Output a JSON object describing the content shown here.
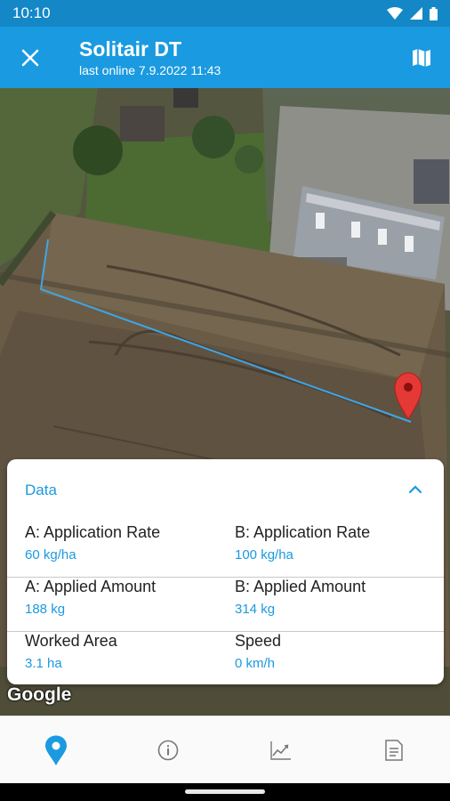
{
  "status_bar": {
    "time": "10:10"
  },
  "header": {
    "title": "Solitair DT",
    "subtitle": "last online 7.9.2022 11:43",
    "close_icon": "close-icon",
    "map_icon": "map-icon",
    "color": "#1a9ae0"
  },
  "map": {
    "attribution": "Google",
    "marker_color": "#e53935",
    "track_color": "#3fa6e6"
  },
  "data_panel": {
    "title": "Data",
    "rows": [
      [
        {
          "label": "A: Application Rate",
          "value": "60 kg/ha"
        },
        {
          "label": "B: Application Rate",
          "value": "100 kg/ha"
        }
      ],
      [
        {
          "label": "A: Applied Amount",
          "value": "188 kg"
        },
        {
          "label": "B: Applied Amount",
          "value": "314 kg"
        }
      ],
      [
        {
          "label": "Worked Area",
          "value": "3.1 ha"
        },
        {
          "label": "Speed",
          "value": "0 km/h"
        }
      ]
    ]
  },
  "bottom_nav": {
    "items": [
      {
        "icon": "location-pin-icon",
        "active": true
      },
      {
        "icon": "info-icon",
        "active": false
      },
      {
        "icon": "chart-icon",
        "active": false
      },
      {
        "icon": "document-icon",
        "active": false
      }
    ],
    "active_color": "#1a9ae0",
    "inactive_color": "#777777"
  }
}
